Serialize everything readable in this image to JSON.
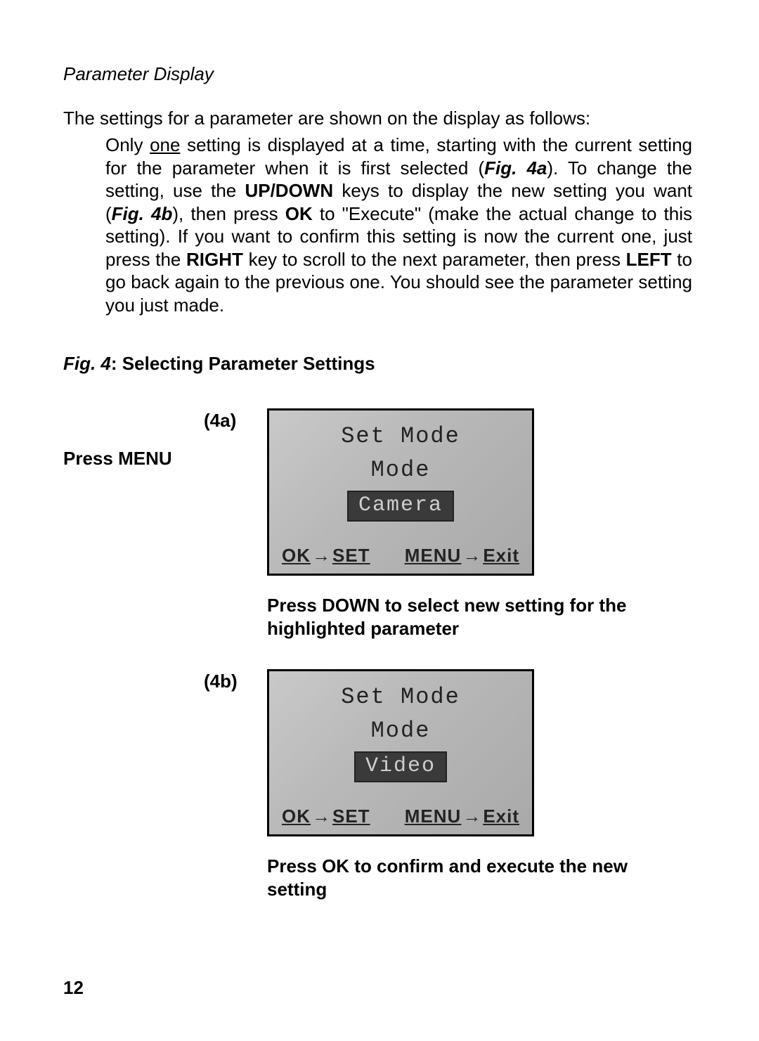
{
  "section_title": "Parameter Display",
  "intro_line": "The settings for a parameter are shown on the display as follows:",
  "body": {
    "s1a": "Only ",
    "s1_one": "one",
    "s1b": " setting is displayed at a time, starting with the current setting for the parameter when it is first selected (",
    "s1_fig4a": "Fig. 4a",
    "s1c": "). To change the setting, use the ",
    "s1_updown": "UP/DOWN",
    "s1d": " keys to display the new setting you want (",
    "s1_fig4b": "Fig. 4b",
    "s1e": "), then press ",
    "s1_ok": "OK",
    "s1f": " to \"Execute\" (make the actual change to this setting). If you want to confirm this setting is now the current one, just press the ",
    "s1_right": "RIGHT",
    "s1g": " key to scroll to the next parameter, then press ",
    "s1_left": "LEFT",
    "s1h": " to go back again to the previous one. You should see the parameter setting you just made."
  },
  "figure_caption": {
    "fig": "Fig. 4",
    "rest": ": Selecting Parameter Settings"
  },
  "fig4a": {
    "label": "(4a)",
    "press_menu": "Press MENU",
    "screen": {
      "title": "Set Mode",
      "param": "Mode",
      "value": "Camera",
      "footer_left_a": "OK",
      "footer_left_b": "SET",
      "footer_right_a": "MENU",
      "footer_right_b": "Exit"
    },
    "after": "Press DOWN to select new setting for the highlighted parameter"
  },
  "fig4b": {
    "label": "(4b)",
    "screen": {
      "title": "Set Mode",
      "param": "Mode",
      "value": "Video",
      "footer_left_a": "OK",
      "footer_left_b": "SET",
      "footer_right_a": "MENU",
      "footer_right_b": "Exit"
    },
    "after": "Press OK to confirm and execute the new setting"
  },
  "page_number": "12"
}
